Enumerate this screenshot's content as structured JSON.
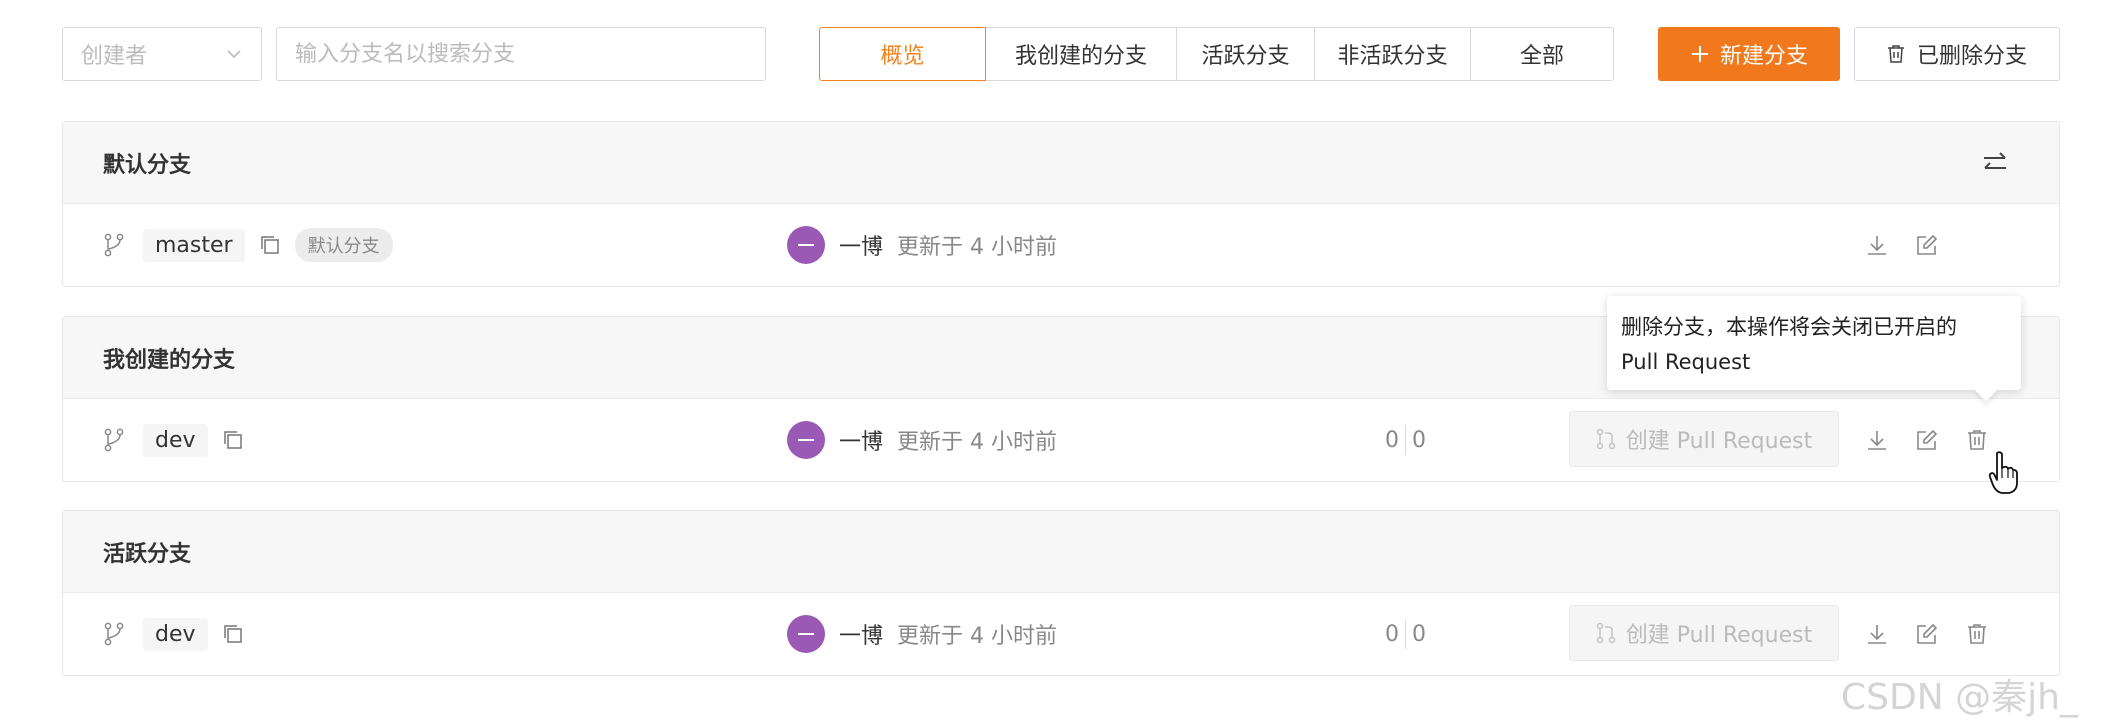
{
  "toolbar": {
    "creator_placeholder": "创建者",
    "search_placeholder": "输入分支名以搜索分支",
    "tabs": [
      {
        "label": "概览",
        "active": true
      },
      {
        "label": "我创建的分支",
        "active": false
      },
      {
        "label": "活跃分支",
        "active": false
      },
      {
        "label": "非活跃分支",
        "active": false
      },
      {
        "label": "全部",
        "active": false
      }
    ],
    "new_branch_label": "新建分支",
    "deleted_branches_label": "已删除分支"
  },
  "sections": {
    "default": {
      "title": "默认分支",
      "row": {
        "branch": "master",
        "badge": "默认分支",
        "author": "一博",
        "updated": "更新于 4 小时前"
      }
    },
    "mine": {
      "title": "我创建的分支",
      "row": {
        "branch": "dev",
        "author": "一博",
        "updated": "更新于 4 小时前",
        "ahead": "0",
        "behind": "0",
        "pr_label": "创建 Pull Request"
      }
    },
    "active": {
      "title": "活跃分支",
      "row": {
        "branch": "dev",
        "author": "一博",
        "updated": "更新于 4 小时前",
        "ahead": "0",
        "behind": "0",
        "pr_label": "创建 Pull Request"
      }
    }
  },
  "tooltip": {
    "line1": "删除分支，本操作将会关闭已开启的",
    "line2": "Pull Request"
  },
  "watermark": "CSDN @秦jh_",
  "colors": {
    "accent": "#f1781c",
    "avatar": "#9b59b6",
    "section_header_bg": "#f7f7f8"
  },
  "icons": [
    "chevron-down-icon",
    "plus-icon",
    "trash-icon",
    "swap-icon",
    "branch-icon",
    "copy-icon",
    "download-icon",
    "edit-icon",
    "pull-request-icon",
    "hand-cursor-icon"
  ]
}
